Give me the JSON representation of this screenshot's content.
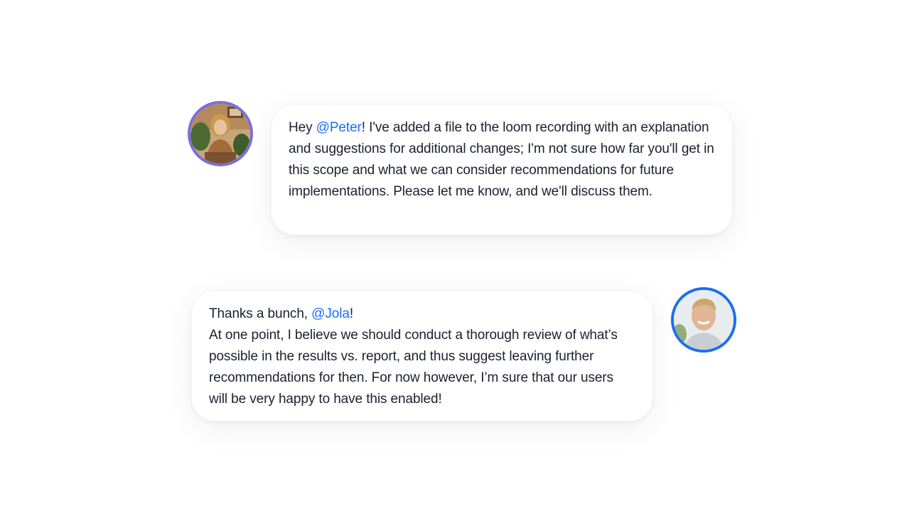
{
  "colors": {
    "jola_ring": "#7b6fd6",
    "peter_ring": "#1a6ef0",
    "mention": "#1a6ef0",
    "text": "#1c2030"
  },
  "messages": [
    {
      "avatar_icon": "avatar-jola-icon",
      "greeting": "Hey ",
      "mention": "@Peter",
      "body": "! I've added a file to the loom recording with an explanation and suggestions for additional changes; I'm not sure how far you'll get in this scope and what we can consider recommendations for future implementations. Please let me know, and we'll discuss them."
    },
    {
      "avatar_icon": "avatar-peter-icon",
      "greeting": "Thanks a bunch, ",
      "mention": "@Jola",
      "after_mention": "!",
      "body": "At one point, I believe we should conduct a thorough review of what’s possible in the results vs. report, and thus suggest leaving further recommendations for then. For now however, I’m sure that our users will be very happy to have this enabled!"
    }
  ]
}
